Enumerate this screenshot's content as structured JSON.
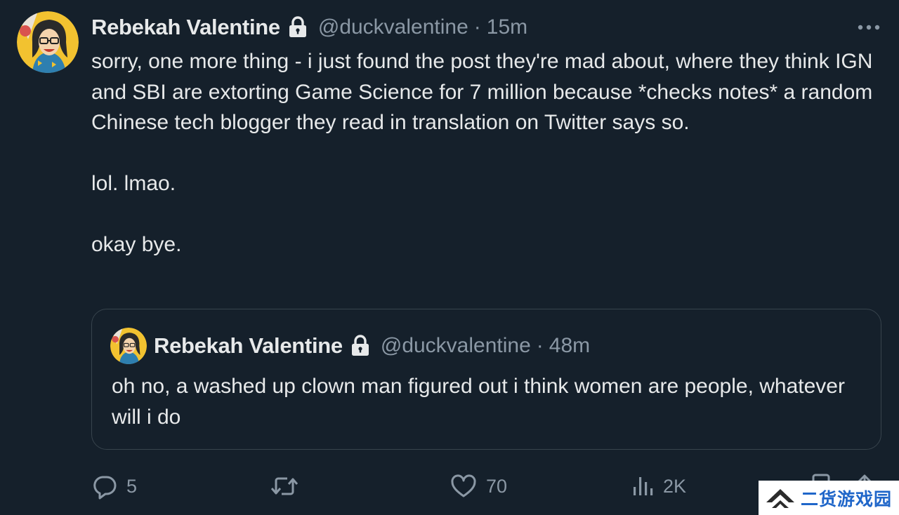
{
  "tweet": {
    "author_name": "Rebekah Valentine",
    "handle": "@duckvalentine",
    "separator": "·",
    "time": "15m",
    "paragraphs": [
      "sorry, one more thing - i just found the post they're mad about, where they think IGN and SBI are extorting Game Science for 7 million because *checks notes* a random Chinese tech blogger they read in translation on Twitter says so.",
      "lol. lmao.",
      "okay bye."
    ]
  },
  "quoted": {
    "author_name": "Rebekah Valentine",
    "handle": "@duckvalentine",
    "separator": "·",
    "time": "48m",
    "text": "oh no, a washed up clown man figured out i think women are people, whatever will i do"
  },
  "actions": {
    "replies": "5",
    "retweets": "",
    "likes": "70",
    "views": "2K"
  },
  "icons": {
    "more": "more-horizontal-icon",
    "lock": "lock-icon",
    "reply": "reply-icon",
    "retweet": "retweet-icon",
    "like": "heart-icon",
    "views": "views-icon",
    "bookmark": "bookmark-icon",
    "share": "share-icon"
  },
  "watermark": {
    "text": "二货游戏园"
  },
  "colors": {
    "background": "#15202b",
    "text_primary": "#e7e9ea",
    "text_secondary": "#8b98a5",
    "border": "#38444d",
    "watermark_text": "#1f66c9"
  }
}
